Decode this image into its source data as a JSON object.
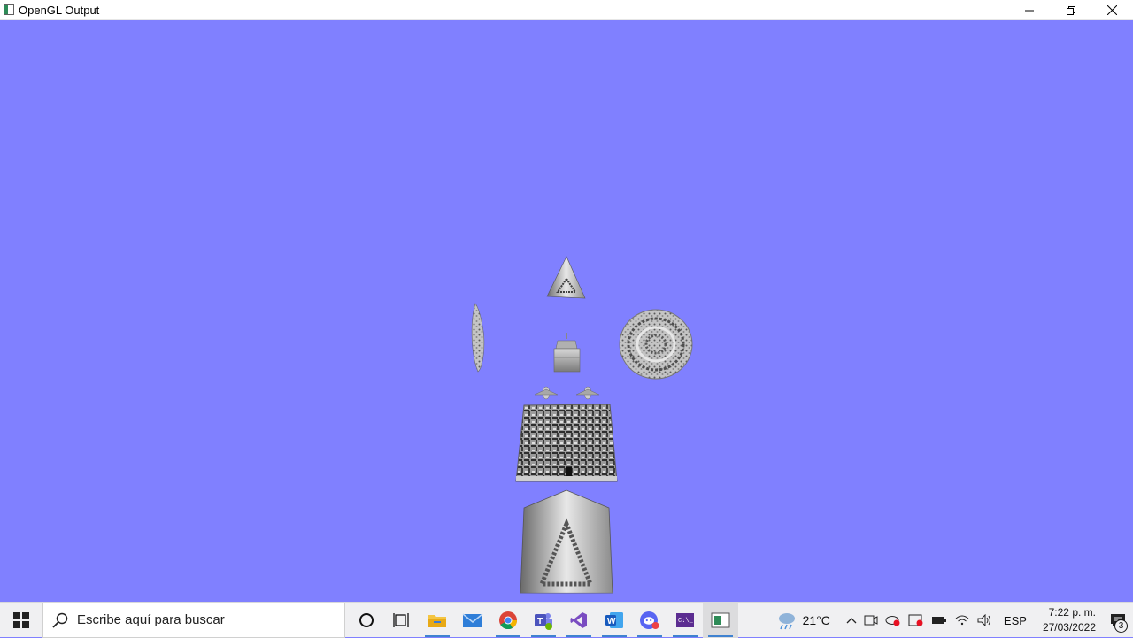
{
  "window": {
    "title": "OpenGL Output",
    "icons": {
      "minimize": "minimize-icon",
      "restore": "restore-icon",
      "close": "close-icon"
    }
  },
  "viewport": {
    "background_color": "#8080ff",
    "objects": [
      "pyramid-small",
      "fish-model",
      "lantern-model",
      "coiled-rope-model",
      "airplane-left",
      "airplane-right",
      "maze-block",
      "pyramid-large"
    ]
  },
  "taskbar": {
    "search_placeholder": "Escribe aquí para buscar",
    "apps": [
      "cortana-icon",
      "task-view-icon",
      "file-explorer-icon",
      "mail-icon",
      "chrome-icon",
      "teams-icon",
      "visual-studio-icon",
      "word-icon",
      "discord-icon",
      "terminal-icon",
      "opengl-app-icon"
    ],
    "weather": {
      "temperature": "21°C",
      "icon": "weather-rain-icon"
    },
    "language": "ESP",
    "clock": {
      "time": "7:22 p. m.",
      "date": "27/03/2022"
    },
    "notifications": {
      "count": "3"
    }
  }
}
